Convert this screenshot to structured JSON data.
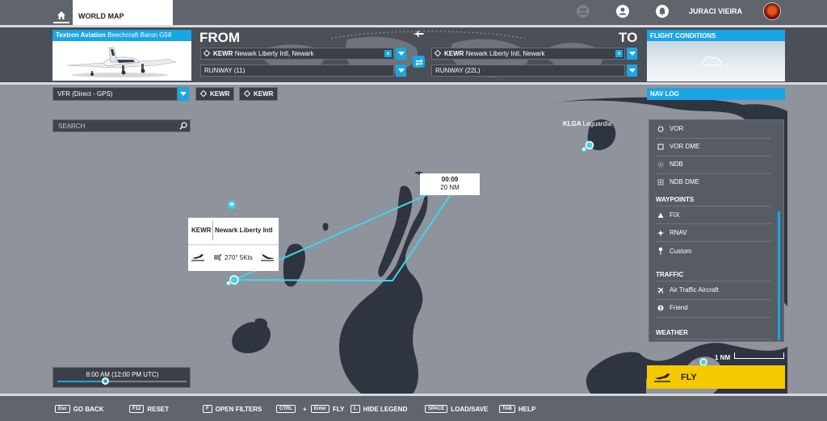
{
  "topbar": {
    "tab_label": "WORLD MAP",
    "username": "JURACI VIEIRA",
    "icons": [
      "home-icon",
      "friends-icon",
      "profile-icon",
      "notifications-icon"
    ]
  },
  "aircraft": {
    "maker": "Textron Aviation",
    "model": "Beechcraft Baron G58"
  },
  "flight": {
    "from_label": "FROM",
    "to_label": "TO",
    "departure_code": "KEWR",
    "departure_name": "Newark Liberty Intl, Newark",
    "departure_runway": "RUNWAY (11)",
    "arrival_code": "KEWR",
    "arrival_name": "Newark Liberty Intl, Newark",
    "arrival_runway": "RUNWAY (22L)",
    "clear_label": "x"
  },
  "conditions": {
    "title": "FLIGHT CONDITIONS"
  },
  "route": {
    "type": "VFR (Direct - GPS)",
    "waypoints": [
      "KEWR",
      "KEWR"
    ]
  },
  "navlog": {
    "tab_label": "NAV LOG"
  },
  "search": {
    "placeholder": "SEARCH"
  },
  "map": {
    "airport_label_code": "KLGA",
    "airport_label_name": "Laguardia",
    "leg_time": "00:09",
    "leg_distance": "20 NM",
    "popup_code": "KEWR",
    "popup_name": "Newark Liberty Intl",
    "popup_wind": "270° 5Kts",
    "scale_label": "1 NM",
    "accent_color": "#1aa6e4",
    "route_color": "#3fd6ec"
  },
  "legend": {
    "items": [
      "VOR",
      "VOR DME",
      "NDB",
      "NDB DME"
    ],
    "waypoints_title": "WAYPOINTS",
    "waypoints": [
      "FIX",
      "RNAV",
      "Custom"
    ],
    "traffic_title": "TRAFFIC",
    "traffic": [
      "Air Traffic Aircraft",
      "Friend"
    ],
    "weather_title": "WEATHER"
  },
  "time": {
    "label": "8:00 AM (12:00 PM UTC)",
    "progress": 0.37
  },
  "fly": {
    "label": "FLY",
    "color": "#f5c900"
  },
  "bottombar": {
    "goback_key": "Esc",
    "goback_label": "GO BACK",
    "reset_key": "F12",
    "reset_label": "RESET",
    "filters_key": "F",
    "filters_label": "OPEN FILTERS",
    "fly_key1": "CTRL",
    "fly_plus": "+",
    "fly_key2": "Enter",
    "fly_label": "FLY",
    "legend_key": "L",
    "legend_label": "HIDE LEGEND",
    "load_key": "SPACE",
    "load_label": "LOAD/SAVE",
    "help_key": "TAB",
    "help_label": "HELP"
  }
}
